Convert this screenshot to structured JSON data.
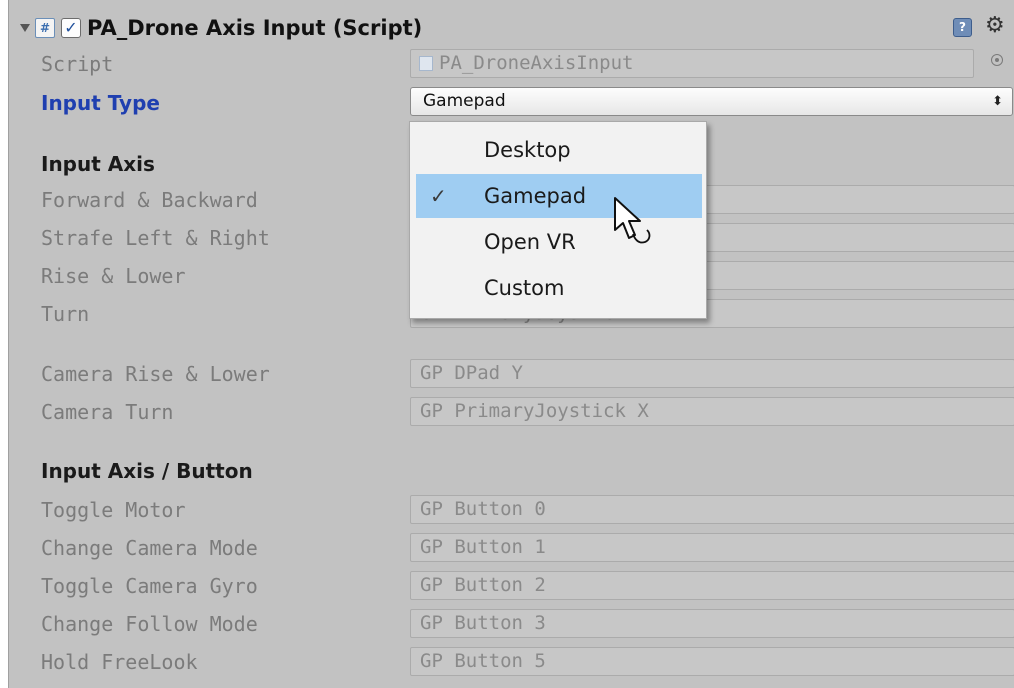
{
  "component": {
    "title": "PA_Drone Axis Input (Script)",
    "enabled": true,
    "icons": {
      "foldout": "foldout-arrow-icon",
      "script": "csharp-script-icon",
      "help": "help-book-icon",
      "settings": "gear-icon"
    }
  },
  "script_row": {
    "label": "Script",
    "value": "PA_DroneAxisInput"
  },
  "input_type_row": {
    "label": "Input Type",
    "value": "Gamepad",
    "arrows": "⬍"
  },
  "dropdown": {
    "options": [
      "Desktop",
      "Gamepad",
      "Open VR",
      "Custom"
    ],
    "selected": "Gamepad",
    "check": "✓"
  },
  "input_axis": {
    "heading": "Input Axis",
    "rows": [
      {
        "label": "Forward & Backward",
        "value": ""
      },
      {
        "label": "Strafe Left & Right",
        "value": ""
      },
      {
        "label": "Rise & Lower",
        "value": ""
      },
      {
        "label": "Turn",
        "value": "GP PrimaryJoystick X"
      }
    ]
  },
  "camera_axis": {
    "rows": [
      {
        "label": "Camera Rise & Lower",
        "value": "GP DPad Y"
      },
      {
        "label": "Camera Turn",
        "value": "GP PrimaryJoystick X"
      }
    ]
  },
  "input_axis_button": {
    "heading": "Input Axis / Button",
    "rows": [
      {
        "label": "Toggle Motor",
        "value": "GP Button 0"
      },
      {
        "label": "Change Camera Mode",
        "value": "GP Button 1"
      },
      {
        "label": "Toggle Camera Gyro",
        "value": "GP Button 2"
      },
      {
        "label": "Change Follow Mode",
        "value": "GP Button 3"
      },
      {
        "label": "Hold FreeLook",
        "value": "GP Button 5"
      }
    ]
  },
  "colors": {
    "panel_bg": "#c2c2c2",
    "label_blue": "#1f3fb0",
    "menu_highlight": "#9fcdf2"
  }
}
